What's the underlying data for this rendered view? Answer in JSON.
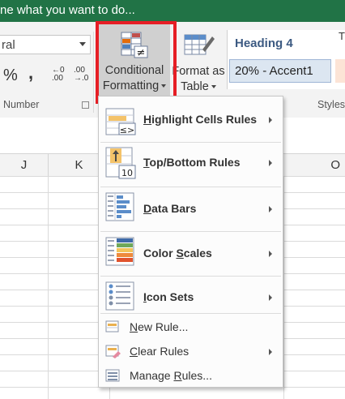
{
  "tell_me": "ne what you want to do...",
  "ribbon": {
    "number_format_value": "ral",
    "percent_symbol": "%",
    "comma_symbol": ",",
    "inc_decimal_top": "←0",
    "inc_decimal_bottom": ".00",
    "dec_decimal_top": ".00",
    "dec_decimal_bottom": "→.0",
    "number_group_label": "Number",
    "styles_group_label": "Styles",
    "cf_button_line1": "Conditional",
    "cf_button_line2": "Formatting",
    "fat_button_line1": "Format as",
    "fat_button_line2": "Table",
    "heading4": "Heading 4",
    "accent_style": "20% - Accent1",
    "next_style_letter": "T"
  },
  "columns": [
    "J",
    "K",
    "O"
  ],
  "menu": {
    "items": [
      {
        "label": "Highlight Cells Rules",
        "mnemonic": "H",
        "submenu": true,
        "icon": "highlight-cells-icon"
      },
      {
        "label": "Top/Bottom Rules",
        "mnemonic": "T",
        "submenu": true,
        "icon": "top-bottom-icon"
      },
      {
        "label": "Data Bars",
        "mnemonic": "D",
        "submenu": true,
        "icon": "data-bars-icon"
      },
      {
        "label": "Color Scales",
        "mnemonic": "S",
        "submenu": true,
        "icon": "color-scales-icon"
      },
      {
        "label": "Icon Sets",
        "mnemonic": "I",
        "submenu": true,
        "icon": "icon-sets-icon"
      },
      {
        "label": "New Rule...",
        "mnemonic": "N",
        "submenu": false,
        "icon": "new-rule-icon"
      },
      {
        "label": "Clear Rules",
        "mnemonic": "C",
        "submenu": true,
        "icon": "clear-rules-icon"
      },
      {
        "label": "Manage Rules...",
        "mnemonic": "R",
        "submenu": false,
        "icon": "manage-rules-icon"
      }
    ]
  },
  "colors": {
    "accent_green": "#217346",
    "highlight_red": "#e61e25"
  }
}
